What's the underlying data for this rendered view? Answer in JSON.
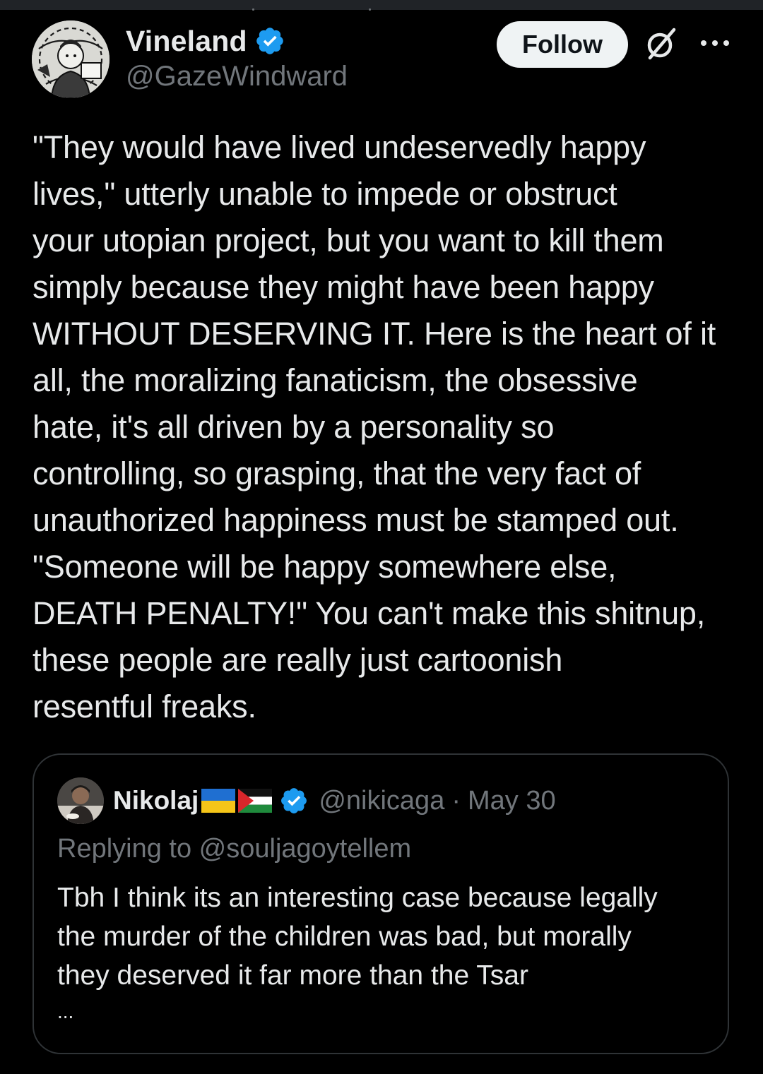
{
  "author": {
    "display_name": "Vineland",
    "handle": "@GazeWindward",
    "verified": true,
    "avatar_icon": "avatar-illustration"
  },
  "actions": {
    "follow_label": "Follow",
    "grok_icon": "grok-icon",
    "more_icon": "more-dots-icon"
  },
  "tweet": {
    "text": "\"They would have lived undeservedly happy\nlives,\" utterly unable to impede or obstruct\nyour utopian project, but you want to kill them\nsimply because they might have been happy\nWITHOUT DESERVING IT. Here is the heart of it\nall, the moralizing fanaticism, the obsessive\nhate, it's all driven by a personality so\ncontrolling, so grasping, that the very fact of\nunauthorized happiness must be stamped out.\n\"Someone will be happy somewhere else,\nDEATH PENALTY!\" You can't make this shitnup,\nthese people are really just cartoonish\nresentful freaks."
  },
  "quote": {
    "display_name": "Nikolaj",
    "flags": [
      "ukraine-flag",
      "palestine-flag"
    ],
    "verified": true,
    "handle": "@nikicaga",
    "separator": "·",
    "date": "May 30",
    "replying_to": "Replying to @souljagoytellem",
    "text": "Tbh I think its an interesting case because legally\nthe murder of the children was bad, but morally\nthey deserved it far more than the Tsar",
    "ellipsis": "..."
  },
  "colors": {
    "background": "#000000",
    "text_primary": "#e7e9ea",
    "text_secondary": "#71767b",
    "verified_blue": "#1d9bf0",
    "border": "#2f3336",
    "follow_bg": "#eff3f4"
  }
}
